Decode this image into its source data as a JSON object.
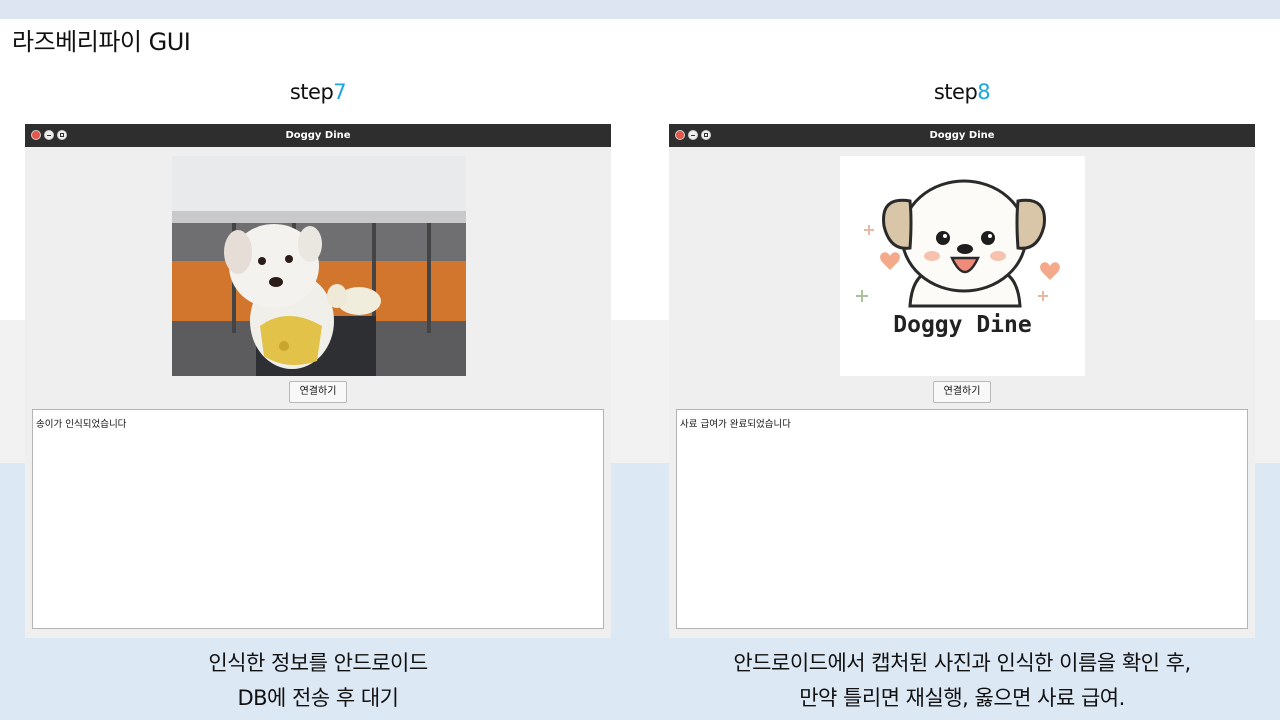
{
  "slide": {
    "title": "라즈베리파이 GUI"
  },
  "panels": [
    {
      "step_prefix": "step",
      "step_number": "7",
      "window_title": "Doggy Dine",
      "image_icon": "dog-photo",
      "connect_label": "연결하기",
      "log_text": "송이가 인식되었습니다",
      "caption_line1": "인식한 정보를 안드로이드",
      "caption_line2": "DB에 전송 후 대기"
    },
    {
      "step_prefix": "step",
      "step_number": "8",
      "window_title": "Doggy Dine",
      "image_icon": "doggy-dine-logo",
      "logo_text": "Doggy Dine",
      "connect_label": "연결하기",
      "log_text": "사료 급여가 완료되었습니다",
      "caption_line1": "안드로이드에서 캡처된 사진과 인식한 이름을 확인 후,",
      "caption_line2": "만약 틀리면 재실행, 옳으면 사료 급여."
    }
  ],
  "colors": {
    "accent": "#19a7e0",
    "titlebar": "#2e2e2e",
    "close_button": "#e4584c"
  }
}
